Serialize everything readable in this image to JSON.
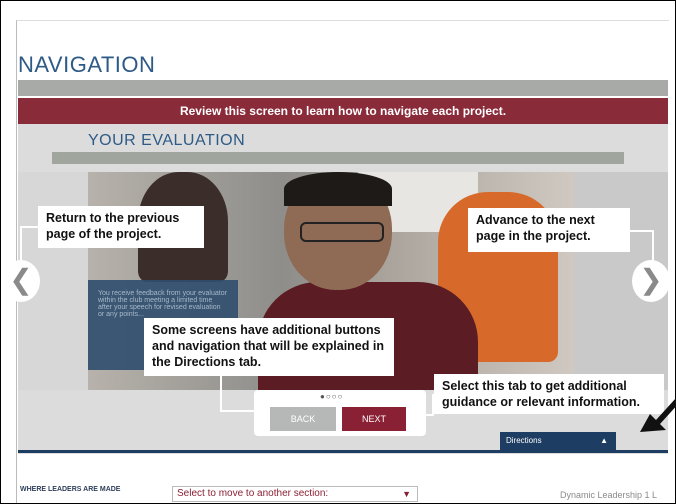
{
  "page": {
    "title": "NAVIGATION",
    "banner": "Review this screen to learn how to navigate each project.",
    "section_title": "YOUR EVALUATION"
  },
  "photo": {
    "overlay_text": "You receive feedback from your evaluator within the club meeting a limited time after your speech for revised evaluation or any points..."
  },
  "callouts": {
    "back": "Return to the previous page of the project.",
    "next": "Advance to the next page in the project.",
    "directions": "Some screens have additional buttons and navigation that will be explained in the Directions tab.",
    "tab": "Select this tab to get additional guidance or relevant information."
  },
  "nav": {
    "left_arrow": "❮",
    "right_arrow": "❯",
    "pager_dots": "●○○○",
    "back_label": "BACK",
    "next_label": "NEXT"
  },
  "directions_tab": {
    "label": "Directions",
    "caret": "▲"
  },
  "footer": {
    "logo_text": "WHERE LEADERS ARE MADE",
    "select_placeholder": "Select to move to another section:",
    "select_caret": "▼",
    "right_text": "Dynamic Leadership 1 L"
  },
  "colors": {
    "brand_blue": "#2e5a86",
    "brand_maroon": "#8a2b3a",
    "navy": "#1d3d63"
  }
}
